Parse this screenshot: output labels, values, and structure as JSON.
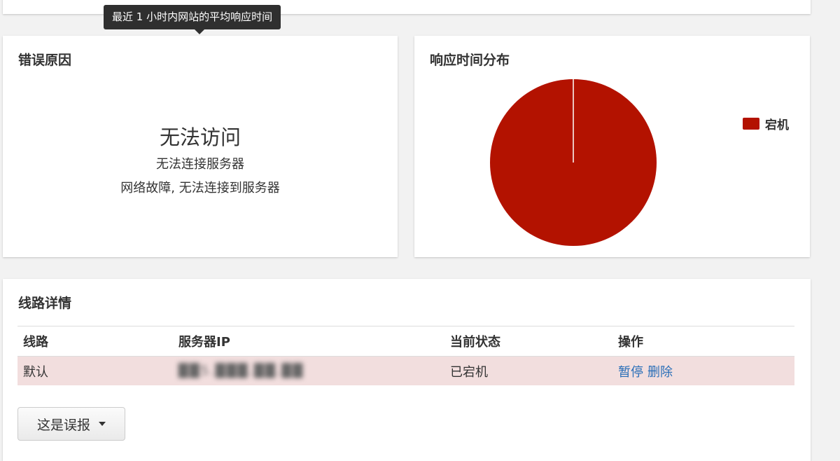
{
  "tooltip": {
    "text": "最近 1 小时内网站的平均响应时间"
  },
  "error_card": {
    "title": "错误原因",
    "main": "无法访问",
    "sub1": "无法连接服务器",
    "sub2": "网络故障, 无法连接到服务器"
  },
  "response_card": {
    "title": "响应时间分布"
  },
  "chart_data": {
    "type": "pie",
    "title": "响应时间分布",
    "slices": [
      {
        "name": "宕机",
        "value": 100,
        "color": "#b31200"
      }
    ],
    "legend_position": "right"
  },
  "lines_card": {
    "title": "线路详情",
    "columns": [
      "线路",
      "服务器IP",
      "当前状态",
      "操作"
    ],
    "rows": [
      {
        "line": "默认",
        "ip": "██5.███.██.██",
        "status": "已宕机",
        "actions": [
          "暂停",
          "删除"
        ]
      }
    ]
  },
  "report_button": {
    "label": "这是误报",
    "icon": "caret-down-icon"
  },
  "colors": {
    "down_row": "#f2dede",
    "link": "#2a6fb8",
    "pie": "#b31200"
  }
}
